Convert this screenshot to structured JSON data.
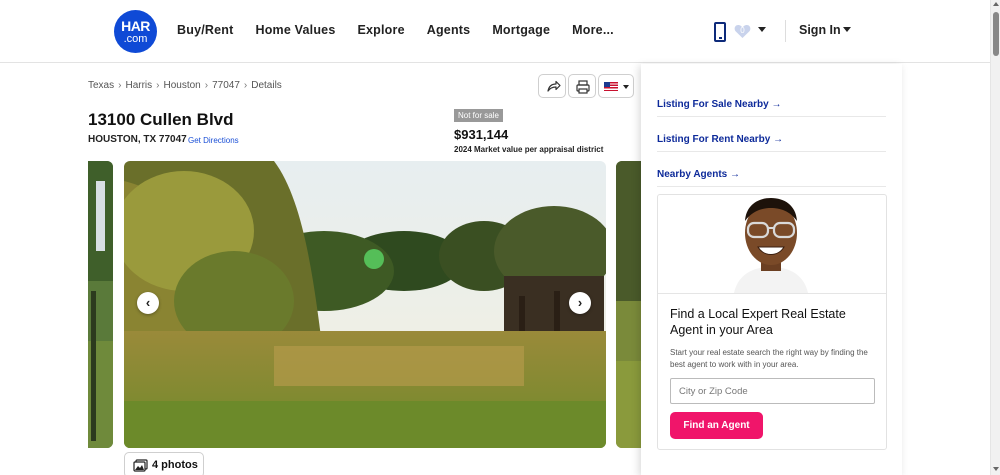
{
  "header": {
    "logo_top": "HAR",
    "logo_bottom": ".com",
    "nav": [
      "Buy/Rent",
      "Home Values",
      "Explore",
      "Agents",
      "Mortgage",
      "More..."
    ],
    "favorites_count": "0",
    "sign_in": "Sign In"
  },
  "breadcrumb": [
    "Texas",
    "Harris",
    "Houston",
    "77047",
    "Details"
  ],
  "listing": {
    "address": "13100 Cullen Blvd",
    "city_line": "HOUSTON, TX 77047",
    "directions": "Get Directions",
    "status_badge": "Not for sale",
    "price": "$931,144",
    "price_note": "2024 Market value per appraisal district",
    "photos_label": "4 photos"
  },
  "panel": {
    "links": [
      "Listing For Sale Nearby →",
      "Listing For Rent Nearby →",
      "Nearby Agents →"
    ],
    "card_title": "Find a Local Expert Real Estate Agent in your Area",
    "card_text": "Start your real estate search the right way by finding the best agent to work with in your area.",
    "input_placeholder": "City or Zip Code",
    "button_label": "Find an Agent"
  },
  "colors": {
    "brand_blue": "#0f4ad6",
    "link_blue": "#0d2a9a",
    "cta_pink": "#f0156a"
  }
}
